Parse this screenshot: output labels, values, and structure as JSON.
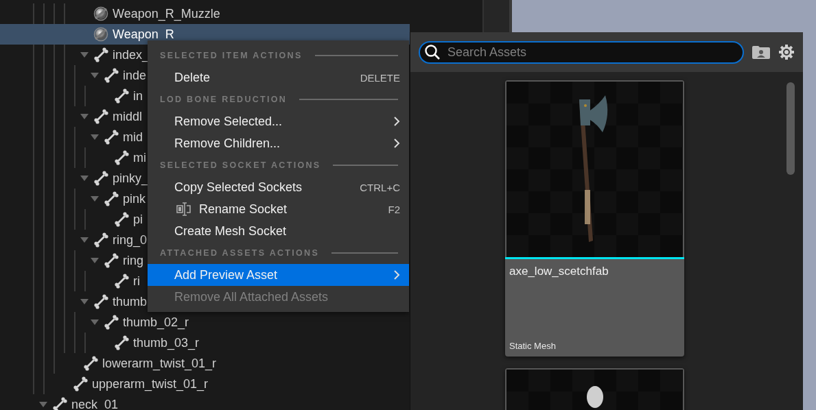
{
  "tree": {
    "rows": [
      [
        [
          [
            [
              {
                "kind": "socket",
                "label": "Weapon_R_Muzzle",
                "selected": false
              },
              {
                "kind": "socket",
                "label": "Weapon_R",
                "selected": true
              },
              {
                "kind": "bone",
                "label": "index_",
                "selected": false,
                "expanded": true,
                "children": [
                  {
                    "kind": "bone",
                    "label": "inde",
                    "selected": false,
                    "expanded": true,
                    "children": [
                      {
                        "kind": "bone",
                        "label": "in",
                        "selected": false
                      }
                    ]
                  }
                ]
              },
              {
                "kind": "bone",
                "label": "middl",
                "selected": false,
                "expanded": true,
                "children": [
                  {
                    "kind": "bone",
                    "label": "mid",
                    "selected": false,
                    "expanded": true,
                    "children": [
                      {
                        "kind": "bone",
                        "label": "mi",
                        "selected": false
                      }
                    ]
                  }
                ]
              },
              {
                "kind": "bone",
                "label": "pinky_",
                "selected": false,
                "expanded": true,
                "children": [
                  {
                    "kind": "bone",
                    "label": "pink",
                    "selected": false,
                    "expanded": true,
                    "children": [
                      {
                        "kind": "bone",
                        "label": "pi",
                        "selected": false
                      }
                    ]
                  }
                ]
              },
              {
                "kind": "bone",
                "label": "ring_0",
                "selected": false,
                "expanded": true,
                "children": [
                  {
                    "kind": "bone",
                    "label": "ring",
                    "selected": false,
                    "expanded": true,
                    "children": [
                      {
                        "kind": "bone",
                        "label": "ri",
                        "selected": false
                      }
                    ]
                  }
                ]
              },
              {
                "kind": "bone",
                "label": "thumb",
                "selected": false,
                "expanded": true,
                "children": [
                  {
                    "kind": "bone",
                    "label": "thumb_02_r",
                    "selected": false,
                    "expanded": true,
                    "children": [
                      {
                        "kind": "bone",
                        "label": "thumb_03_r",
                        "selected": false
                      }
                    ]
                  }
                ]
              }
            ],
            {
              "kind": "bone",
              "label": "lowerarm_twist_01_r",
              "selected": false
            }
          ],
          {
            "kind": "bone",
            "label": "upperarm_twist_01_r",
            "selected": false
          }
        ]
      ],
      {
        "kind": "bone",
        "label": "neck_01",
        "selected": false,
        "expanded": true
      }
    ]
  },
  "context_menu": {
    "sections": [
      {
        "title": "SELECTED ITEM ACTIONS",
        "items": [
          {
            "kind": "plain",
            "label": "Delete",
            "shortcut": "DELETE",
            "selected": false,
            "disabled": false
          }
        ]
      },
      {
        "title": "LOD BONE REDUCTION",
        "items": [
          {
            "kind": "submenu",
            "label": "Remove Selected...",
            "selected": false,
            "disabled": false
          },
          {
            "kind": "submenu",
            "label": "Remove Children...",
            "selected": false,
            "disabled": false
          }
        ]
      },
      {
        "title": "SELECTED SOCKET ACTIONS",
        "items": [
          {
            "kind": "plain",
            "label": "Copy Selected Sockets",
            "shortcut": "CTRL+C",
            "selected": false,
            "disabled": false
          },
          {
            "kind": "icon",
            "label": "Rename Socket",
            "shortcut": "F2",
            "selected": false,
            "disabled": false
          },
          {
            "kind": "plain",
            "label": "Create Mesh Socket",
            "selected": false,
            "disabled": false
          }
        ]
      },
      {
        "title": "ATTACHED ASSETS ACTIONS",
        "items": [
          {
            "kind": "submenu",
            "label": "Add Preview Asset",
            "selected": true,
            "disabled": false
          },
          {
            "kind": "plain",
            "label": "Remove All Attached Assets",
            "selected": false,
            "disabled": true
          }
        ]
      }
    ]
  },
  "asset_picker": {
    "search": {
      "placeholder": "Search Assets"
    },
    "assets": [
      {
        "kind": "axe",
        "name": "axe_low_scetchfab",
        "type": "Static Mesh",
        "color": "#00e5f0"
      },
      {
        "kind": "figure"
      }
    ]
  }
}
